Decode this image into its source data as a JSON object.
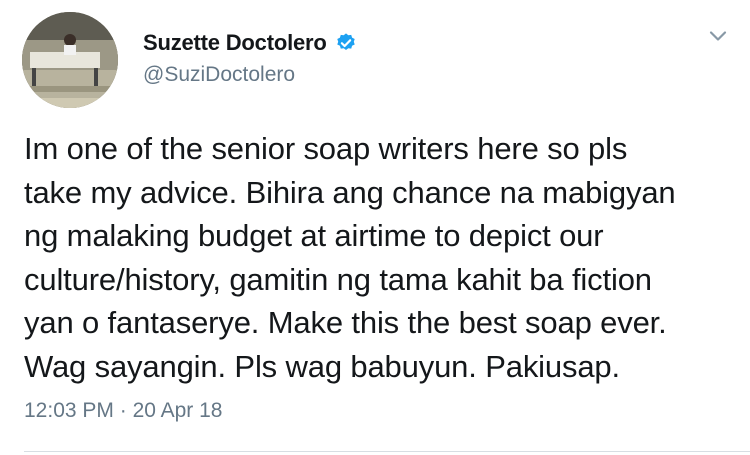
{
  "author": {
    "display_name": "Suzette Doctolero",
    "handle": "@SuziDoctolero",
    "verified": true,
    "verified_color": "#1da1f2"
  },
  "tweet": {
    "text": "Im one of the senior soap writers here so pls\ntake my advice. Bihira ang chance na mabigyan\nng malaking budget at airtime to depict our\nculture/history, gamitin ng tama kahit ba fiction\nyan o fantaserye.  Make this the best soap ever.\nWag sayangin.  Pls wag babuyun.  Pakiusap.",
    "time": "12:03 PM",
    "separator": "·",
    "date": "20 Apr 18"
  },
  "icons": {
    "verified": "verified-badge-icon",
    "more": "chevron-down-icon"
  },
  "colors": {
    "text": "#14171a",
    "secondary": "#657786",
    "divider": "#d8dee3"
  }
}
